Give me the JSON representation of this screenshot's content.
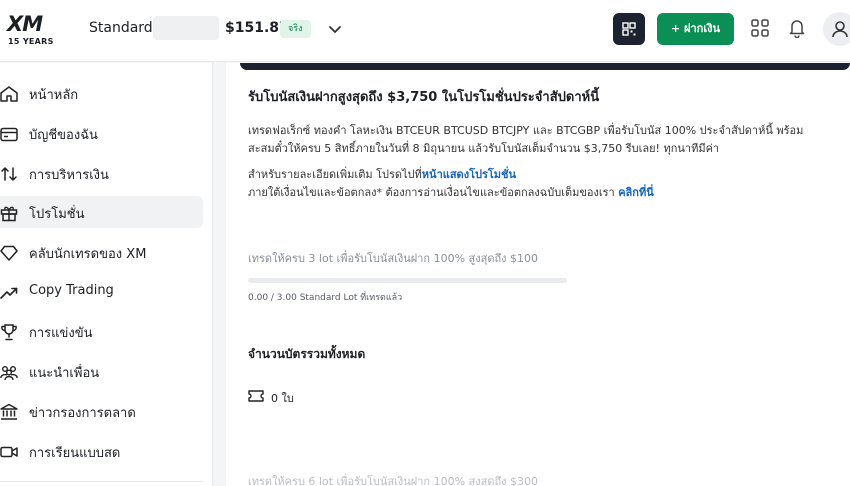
{
  "header": {
    "logo": {
      "brand": "XM",
      "tagline": "15 YEARS"
    },
    "account": {
      "type": "Standard (",
      "balance": "$151.87",
      "mode_badge": "จริง"
    },
    "deposit_label": "+ ฝากเงิน"
  },
  "sidebar": {
    "items": [
      {
        "label": "หน้าหลัก",
        "icon": "home-icon"
      },
      {
        "label": "บัญชีของฉัน",
        "icon": "wallet-icon"
      },
      {
        "label": "การบริหารเงิน",
        "icon": "transfer-icon"
      },
      {
        "label": "โปรโมชั่น",
        "icon": "gift-icon",
        "active": true
      },
      {
        "label": "คลับนักเทรดของ XM",
        "icon": "diamond-icon"
      },
      {
        "label": "Copy Trading",
        "icon": "trend-icon"
      },
      {
        "label": "การแข่งขัน",
        "icon": "trophy-icon"
      },
      {
        "label": "แนะนำเพื่อน",
        "icon": "friends-icon"
      },
      {
        "label": "ข่าวกรองการตลาด",
        "icon": "bank-icon"
      },
      {
        "label": "การเรียนแบบสด",
        "icon": "video-icon"
      }
    ]
  },
  "promo": {
    "title": "รับโบนัสเงินฝากสูงสุดถึง $3,750 ในโปรโมชั่นประจำสัปดาห์นี้",
    "description": "เทรดฟอเร็กซ์ ทองคำ โลหะเงิน BTCEUR BTCUSD BTCJPY และ BTCGBP เพื่อรับโบนัส 100% ประจำสัปดาห์นี้ พร้อมสะสมตั๋วให้ครบ 5 สิทธิ์ภายในวันที่ 8 มิถุนายน แล้วรับโบนัสเต็มจำนวน $3,750 รีบเลย! ทุกนาทีมีค่า",
    "more_info_prefix": "สำหรับรายละเอียดเพิ่มเติม โปรดไปที่",
    "more_info_link": "หน้าแสดงโปรโมชั่น",
    "terms_prefix": "ภายใต้เงื่อนไขและข้อตกลง* ต้องการอ่านเงื่อนไขและข้อตกลงฉบับเต็มของเรา ",
    "terms_link": "คลิกที่นี่",
    "tier1_label": "เทรดให้ครบ 3 lot เพื่อรับโบนัสเงินฝาก 100% สูงสุดถึง $100",
    "tier1_progress_text": "0.00 / 3.00 Standard Lot ที่เทรดแล้ว",
    "tier1_progress_fraction": 0,
    "total_title": "จำนวนบัตรรวมทั้งหมด",
    "ticket_count": "0 ใบ",
    "tier2_label": "เทรดให้ครบ 6 lot เพื่อรับโบนัสเงินฝาก 100% สูงสุดถึง $300"
  },
  "colors": {
    "accent_green": "#0a8f55",
    "dark_navy": "#1c2230",
    "link_blue": "#1565c0",
    "logo_red": "#d51820"
  }
}
